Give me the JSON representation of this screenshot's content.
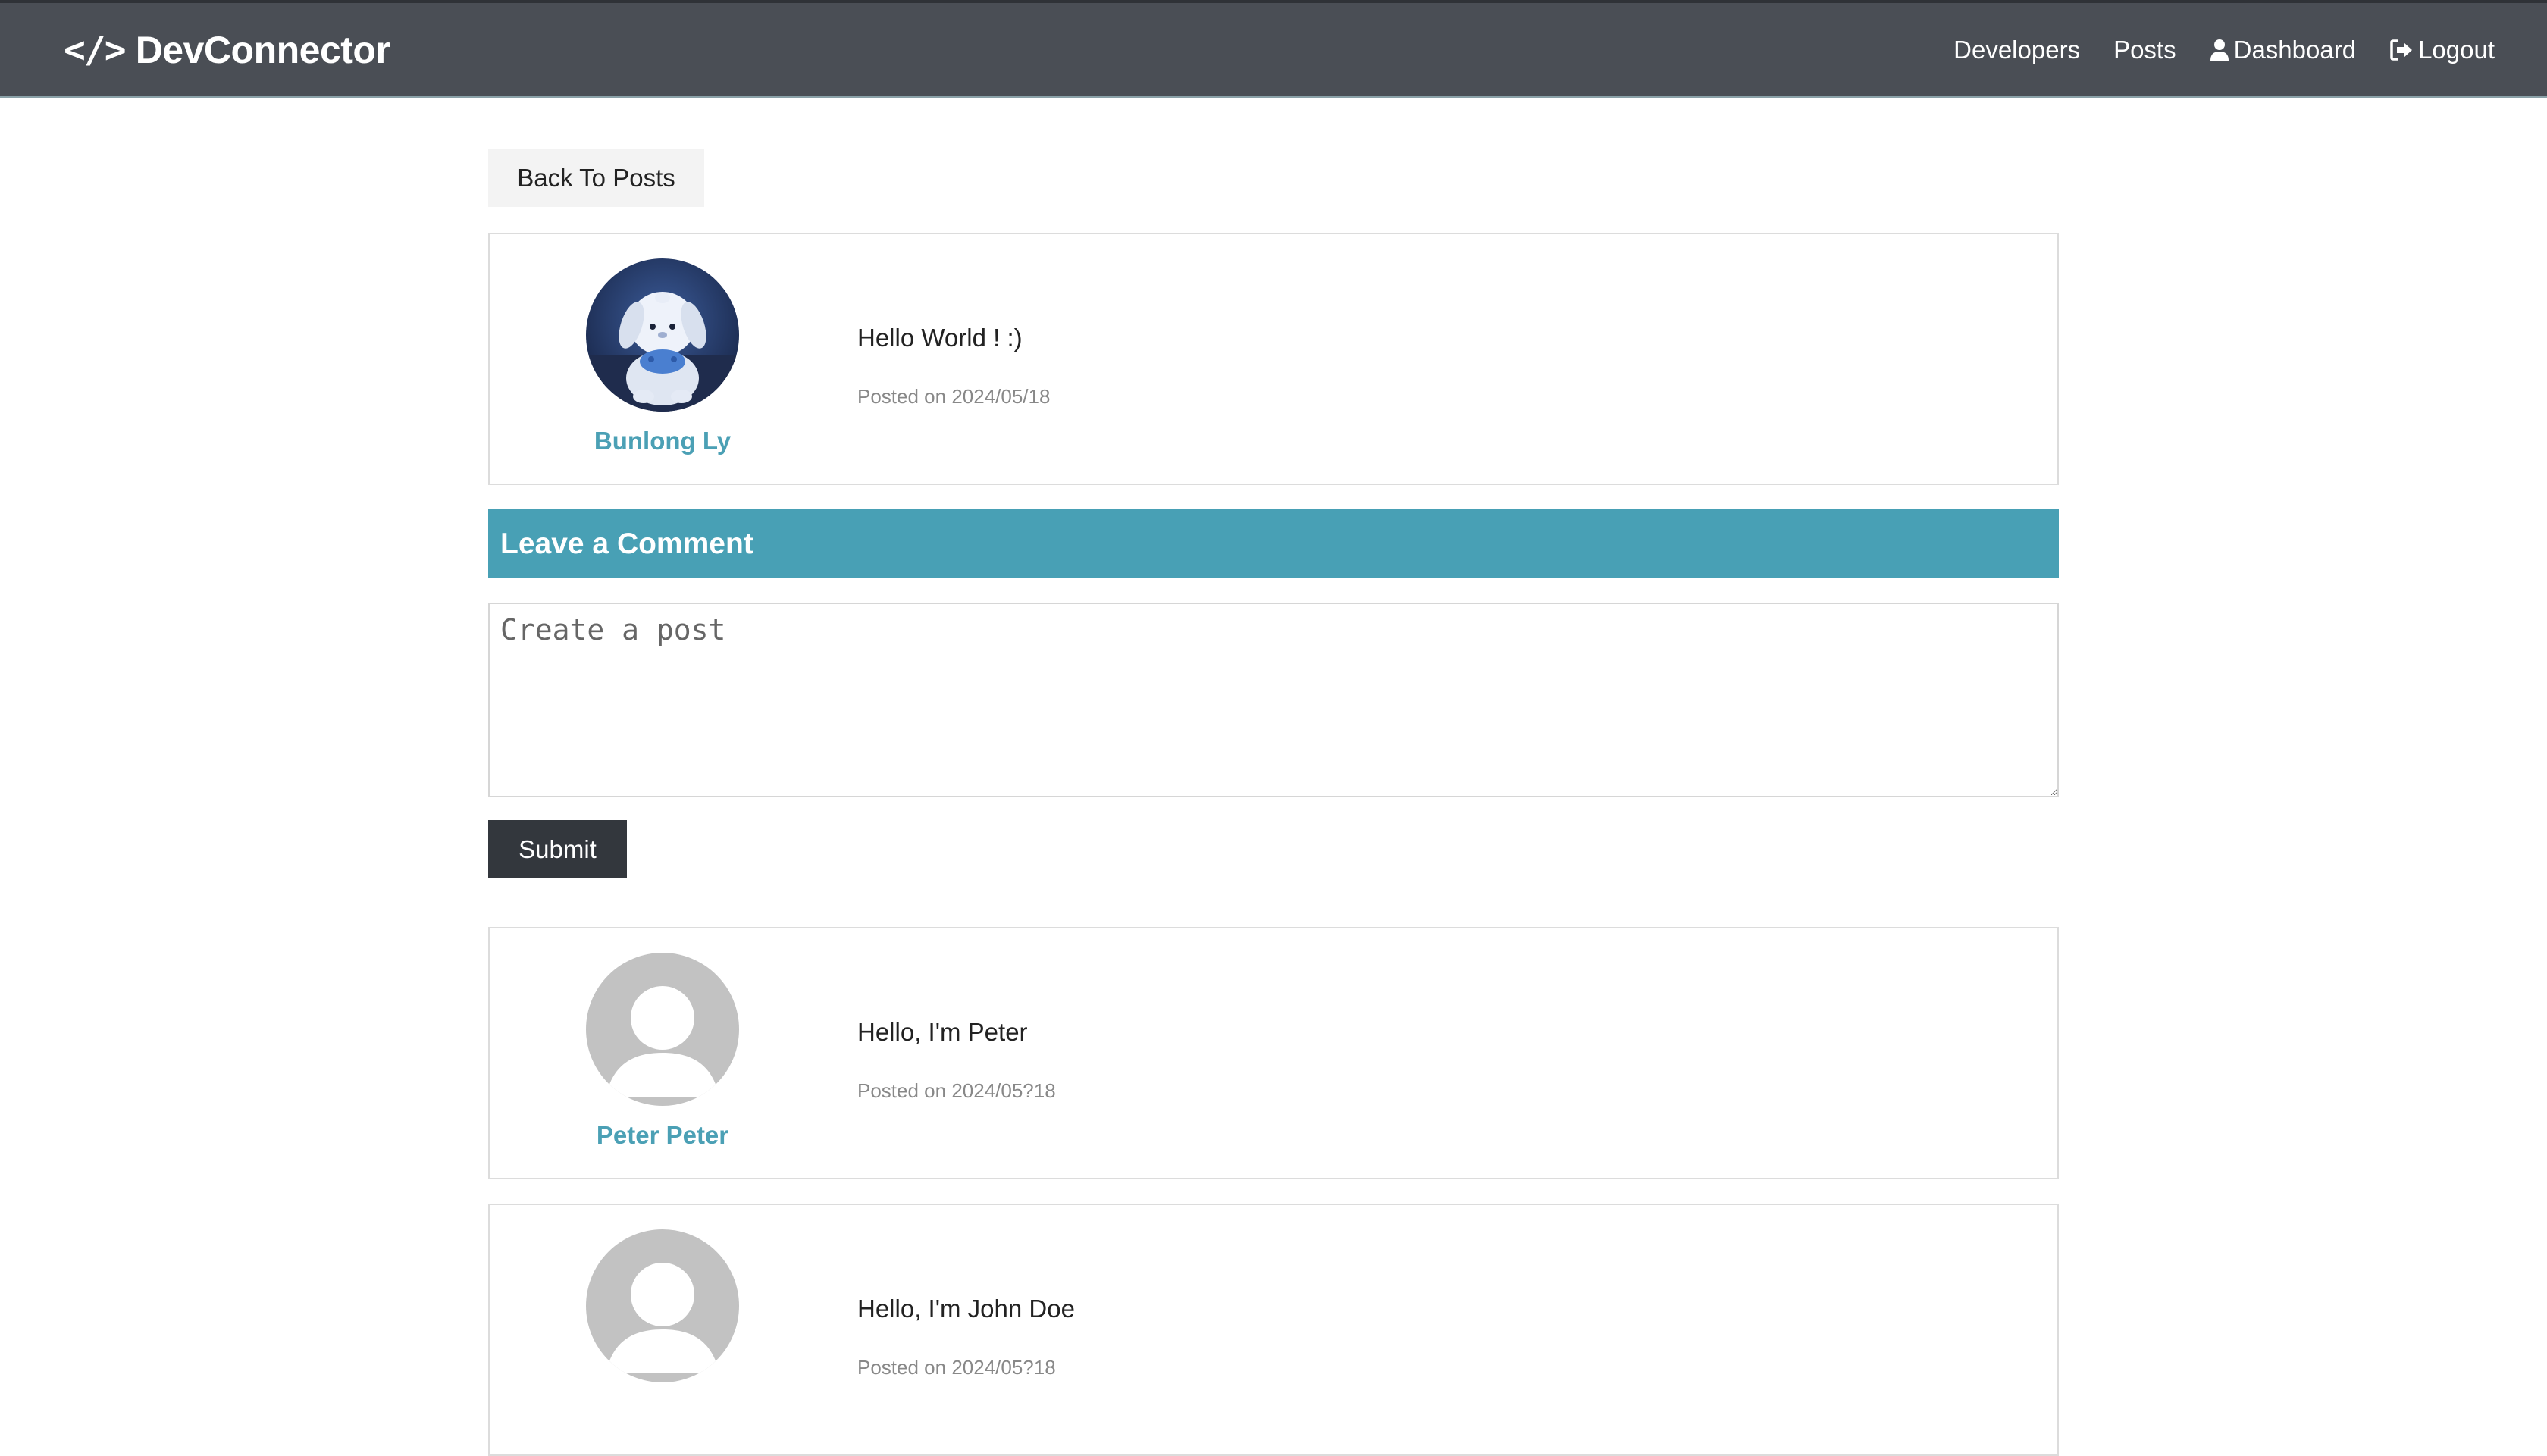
{
  "navbar": {
    "brand_icon": "</>",
    "brand": "DevConnector",
    "links": {
      "developers": "Developers",
      "posts": "Posts",
      "dashboard": "Dashboard",
      "logout": "Logout"
    }
  },
  "back_button": "Back To Posts",
  "post": {
    "author": "Bunlong Ly",
    "text": "Hello World ! :)",
    "date": "Posted on 2024/05/18"
  },
  "comment_form": {
    "header": "Leave a Comment",
    "placeholder": "Create a post",
    "submit": "Submit"
  },
  "comments": [
    {
      "author": "Peter Peter",
      "text": "Hello, I'm Peter",
      "date": "Posted on 2024/05?18"
    },
    {
      "author": "",
      "text": "Hello, I'm John Doe",
      "date": "Posted on 2024/05?18"
    }
  ],
  "colors": {
    "navbar": "#4a4e55",
    "primary": "#48a0b5",
    "dark": "#33373d",
    "light": "#f3f3f3"
  }
}
